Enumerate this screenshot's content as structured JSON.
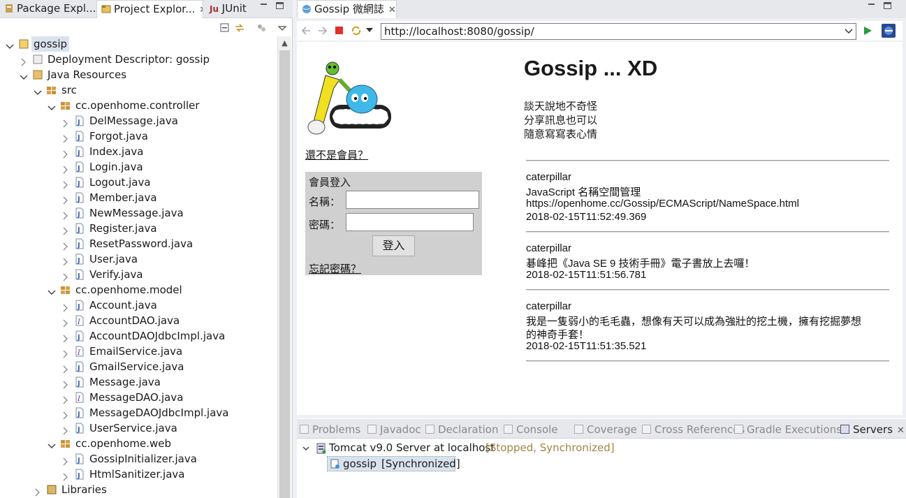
{
  "left_tabs": [
    {
      "label": "Package Expl...",
      "active": false
    },
    {
      "label": "Project Explor...",
      "active": true
    },
    {
      "label": "JUnit",
      "active": false
    }
  ],
  "tree": {
    "project": "gossip",
    "deployment_descriptor": "Deployment Descriptor: gossip",
    "java_resources": "Java Resources",
    "src": "src",
    "packages": [
      {
        "name": "cc.openhome.controller",
        "files": [
          "DelMessage.java",
          "Forgot.java",
          "Index.java",
          "Login.java",
          "Logout.java",
          "Member.java",
          "NewMessage.java",
          "Register.java",
          "ResetPassword.java",
          "User.java",
          "Verify.java"
        ]
      },
      {
        "name": "cc.openhome.model",
        "files": [
          "Account.java",
          "AccountDAO.java",
          "AccountDAOJdbcImpl.java",
          "EmailService.java",
          "GmailService.java",
          "Message.java",
          "MessageDAO.java",
          "MessageDAOJdbcImpl.java",
          "UserService.java"
        ]
      },
      {
        "name": "cc.openhome.web",
        "files": [
          "GossipInitializer.java",
          "HtmlSanitizer.java"
        ]
      }
    ],
    "libraries": "Libraries"
  },
  "browser": {
    "tab_label": "Gossip 微網誌",
    "url": "http://localhost:8080/gossip/"
  },
  "page": {
    "title": "Gossip ... XD",
    "tagline": [
      "談天說地不奇怪",
      "分享訊息也可以",
      "隨意寫寫表心情"
    ],
    "register_link": "還不是會員？",
    "login": {
      "heading": "會員登入",
      "name_label": "名稱：",
      "password_label": "密碼：",
      "name_value": "",
      "password_value": "",
      "submit": "登入",
      "forgot_link": "忘記密碼？"
    },
    "messages": [
      {
        "user": "caterpillar",
        "lines": [
          "JavaScript 名稱空間管理",
          "https://openhome.cc/Gossip/ECMAScript/NameSpace.html"
        ],
        "time": "2018-02-15T11:52:49.369"
      },
      {
        "user": "caterpillar",
        "lines": [
          "碁峰把《Java SE 9 技術手冊》電子書放上去囉！"
        ],
        "time": "2018-02-15T11:51:56.781"
      },
      {
        "user": "caterpillar",
        "lines": [
          "我是一隻弱小的毛毛蟲，想像有天可以成為強壯的挖土機，擁有挖掘夢想",
          "的神奇手套！"
        ],
        "time": "2018-02-15T11:51:35.521"
      }
    ]
  },
  "bottom_tabs": [
    {
      "label": "Problems",
      "icon": "problems-icon"
    },
    {
      "label": "Javadoc",
      "icon": "javadoc-icon"
    },
    {
      "label": "Declaration",
      "icon": "declaration-icon"
    },
    {
      "label": "Console",
      "icon": "console-icon"
    },
    {
      "label": "Coverage",
      "icon": "coverage-icon"
    },
    {
      "label": "Cross References",
      "icon": "cross-references-icon"
    },
    {
      "label": "Gradle Executions",
      "icon": "gradle-icon"
    },
    {
      "label": "Servers",
      "icon": "servers-icon",
      "active": true
    }
  ],
  "servers": {
    "server_name": "Tomcat v9.0 Server at localhost",
    "server_state": "[Stopped, Synchronized]",
    "module_name": "gossip",
    "module_state": "[Synchronized]"
  },
  "colors": {
    "accent": "#3875d7",
    "state_text": "#a28444",
    "login_bg": "#d0d0d0"
  }
}
